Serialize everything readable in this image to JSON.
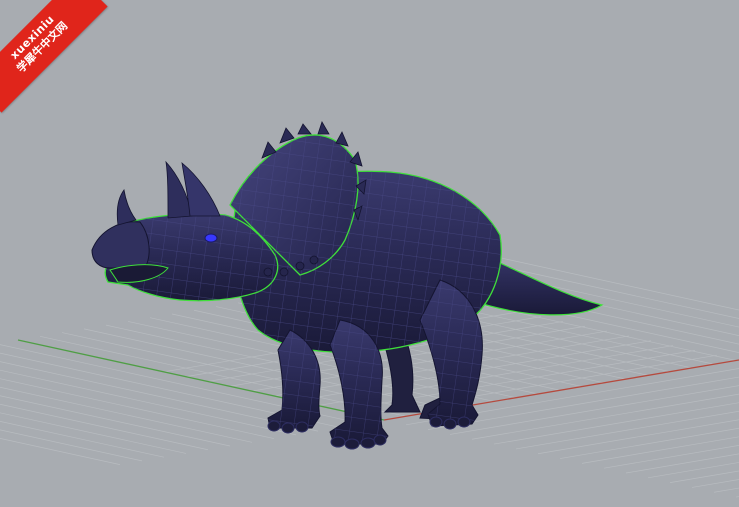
{
  "viewport": {
    "view_name": "perspective",
    "background_color": "#a8acb1",
    "grid_color": "#b8bcc0",
    "x_axis_color": "#b54a3e",
    "y_axis_color": "#4f9e45"
  },
  "model": {
    "name": "triceratops-model",
    "surface_color": "#2a2a55",
    "isocurve_color": "#4a4a88",
    "selection_outline_color": "#3fe03a",
    "eye_color": "#3838ff"
  },
  "watermark": {
    "line1": "xuexiniu",
    "line2": "学犀牛中文网",
    "color": "#e0251b"
  }
}
